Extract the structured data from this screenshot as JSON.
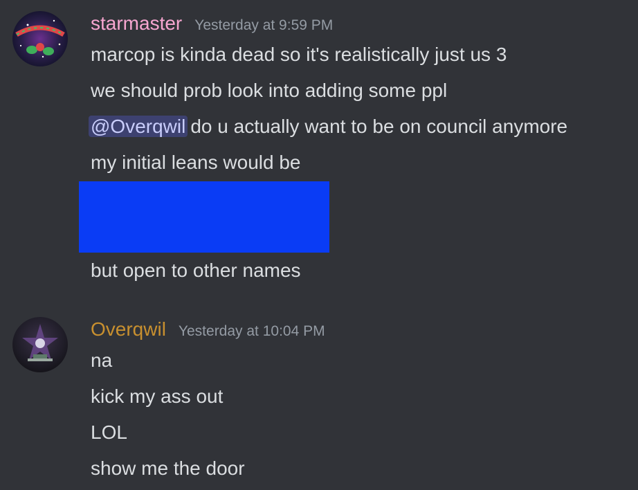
{
  "messages": [
    {
      "author": "starmaster",
      "timestamp": "Yesterday at 9:59 PM",
      "avatar_icon": "starmaster-avatar-icon",
      "author_color": "#f7a6d0",
      "lines": {
        "l1": "marcop is kinda dead so it's realistically just us 3",
        "l2": "we should prob look into adding some ppl",
        "l3_mention": "@Overqwil",
        "l3_rest": "do u actually want to be on council anymore",
        "l4": "my initial leans would be",
        "l5": "but open to other names"
      },
      "redacted_color": "#0a3cf5"
    },
    {
      "author": "Overqwil",
      "timestamp": "Yesterday at 10:04 PM",
      "avatar_icon": "overqwil-avatar-icon",
      "author_color": "#c8902f",
      "lines": {
        "l1": "na",
        "l2": "kick my ass out",
        "l3": "LOL",
        "l4": "show me the door"
      }
    }
  ]
}
